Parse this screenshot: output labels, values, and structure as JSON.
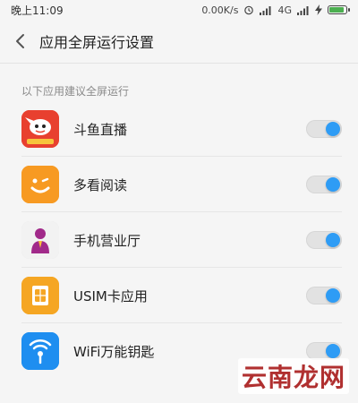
{
  "status_bar": {
    "time": "晚上11:09",
    "speed": "0.00K/s",
    "network": "4G"
  },
  "header": {
    "title": "应用全屏运行设置"
  },
  "section": {
    "label": "以下应用建议全屏运行"
  },
  "apps": [
    {
      "label": "斗鱼直播",
      "icon": "douyu-app-icon",
      "enabled": true
    },
    {
      "label": "多看阅读",
      "icon": "duokan-app-icon",
      "enabled": true
    },
    {
      "label": "手机营业厅",
      "icon": "mobile-hall-app-icon",
      "enabled": true
    },
    {
      "label": "USIM卡应用",
      "icon": "sim-card-app-icon",
      "enabled": true
    },
    {
      "label": "WiFi万能钥匙",
      "icon": "wifi-key-app-icon",
      "enabled": true
    }
  ],
  "watermark": "云南龙网",
  "colors": {
    "toggle_on": "#2e9cf5",
    "background": "#f5f5f5"
  }
}
